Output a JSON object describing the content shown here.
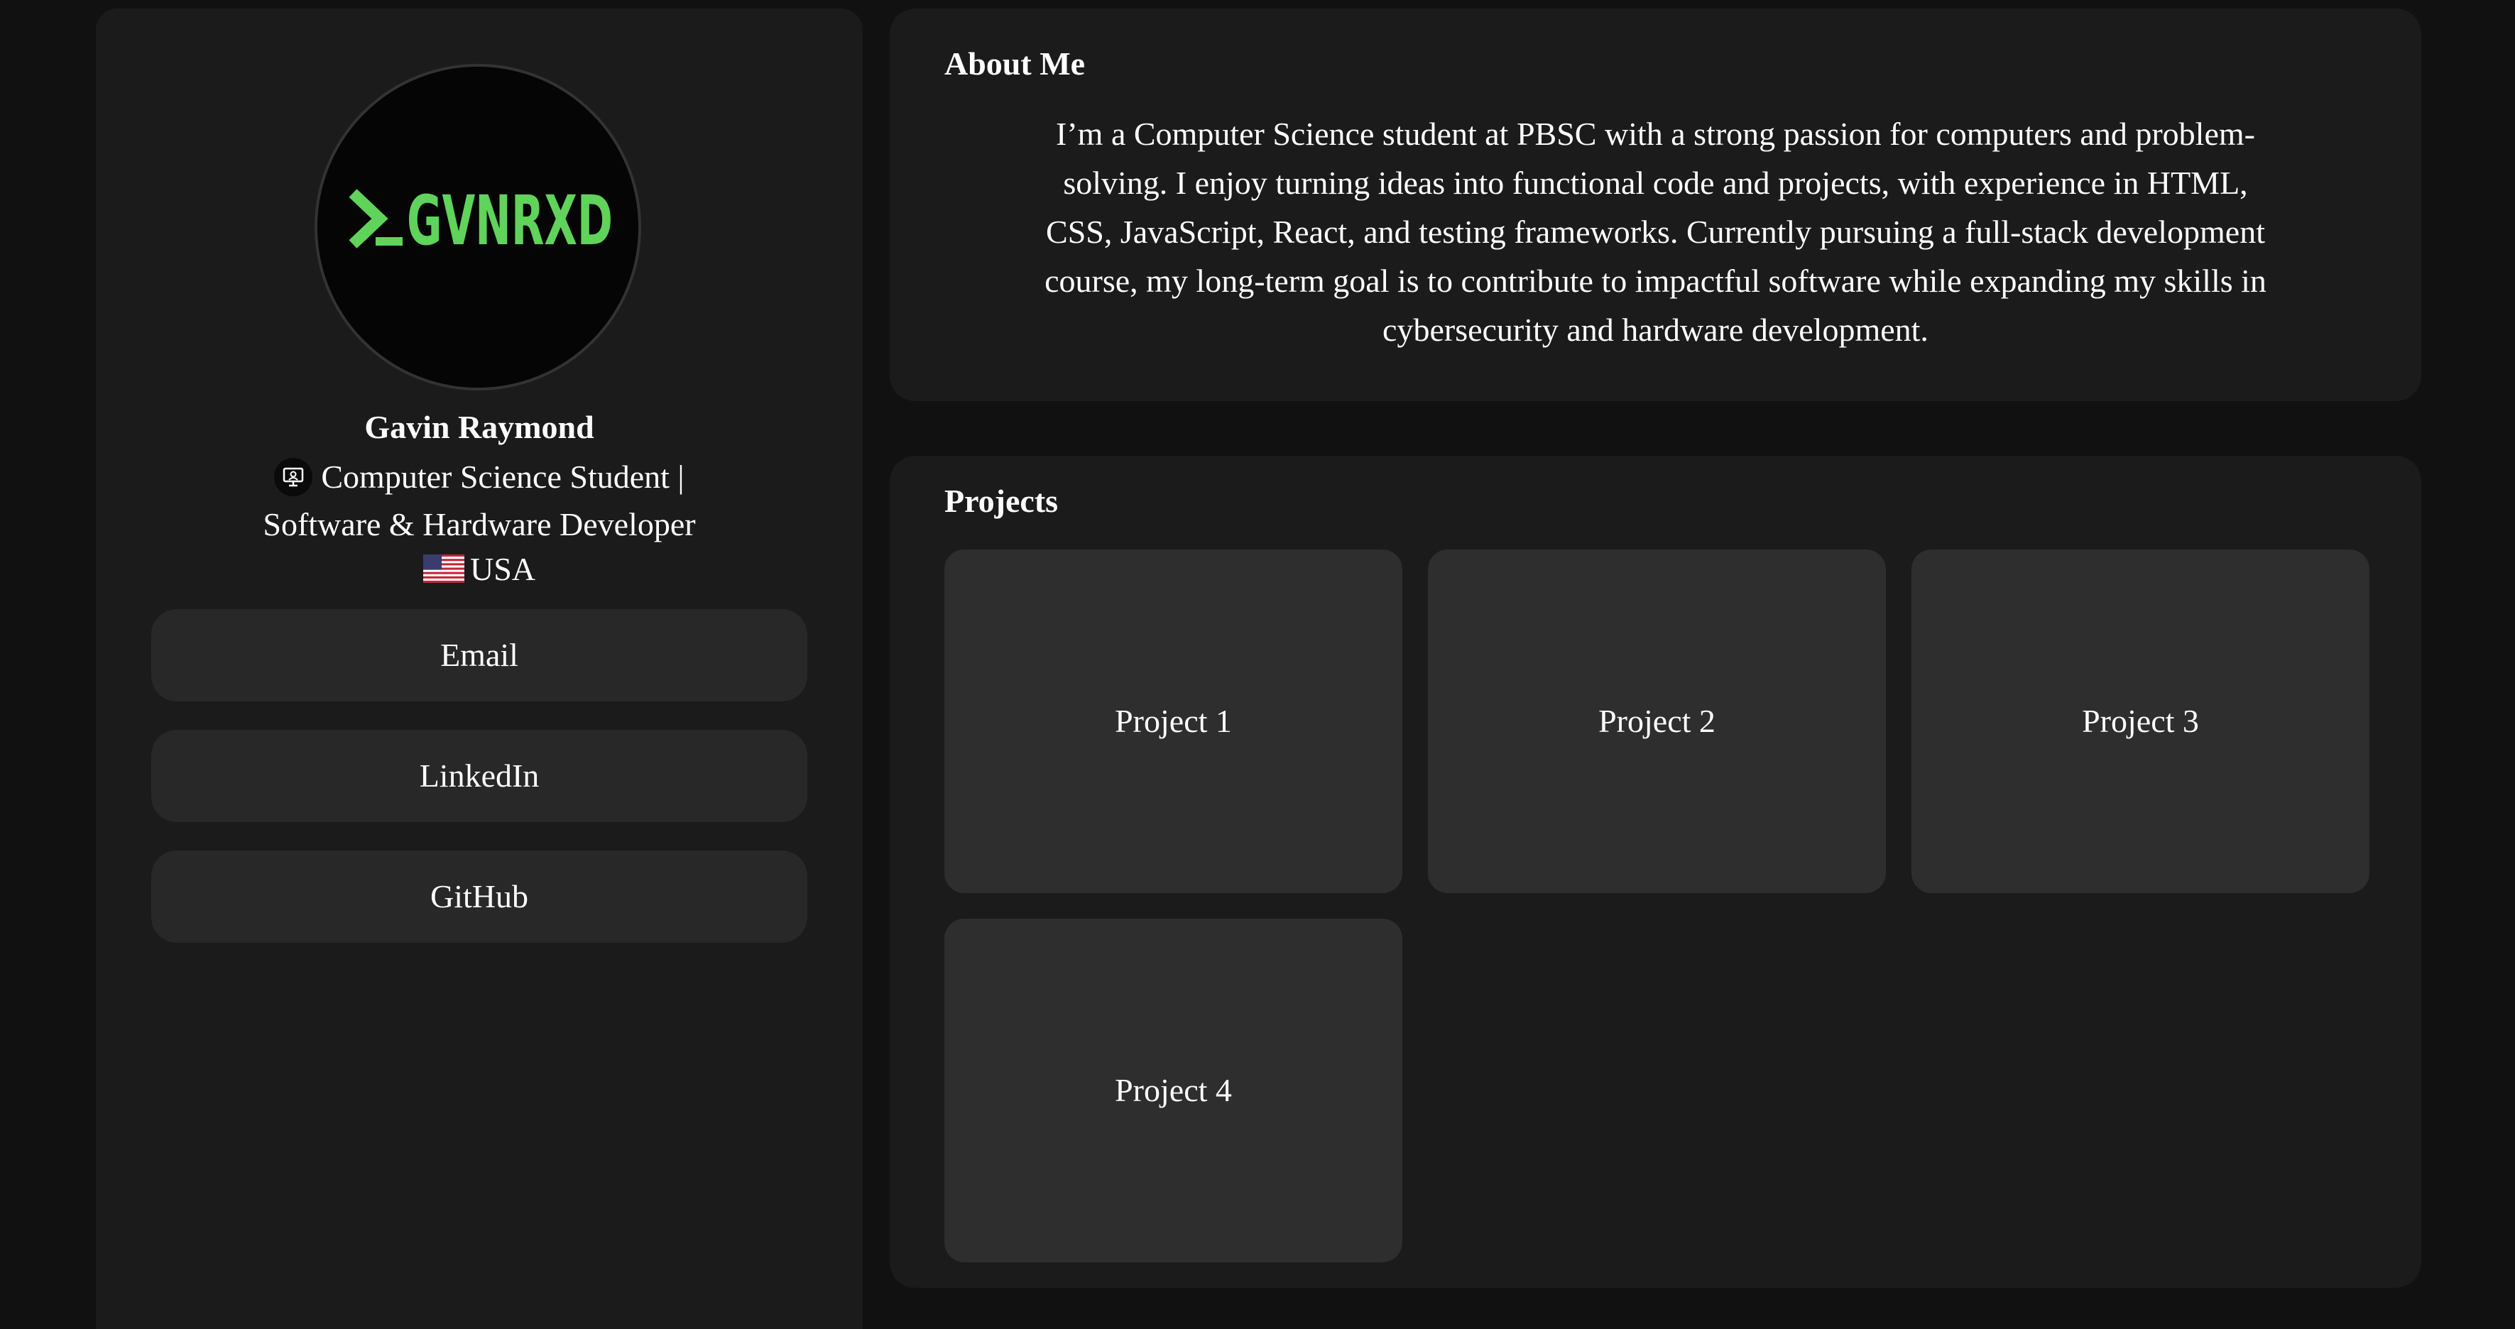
{
  "profile": {
    "logo_text": ">_GVNRXD",
    "name": "Gavin Raymond",
    "role": "Computer Science Student | Software & Hardware Developer",
    "location": "USA",
    "role_icon": "monitor-icon",
    "location_icon": "us-flag-icon"
  },
  "links": [
    {
      "label": "Email"
    },
    {
      "label": "LinkedIn"
    },
    {
      "label": "GitHub"
    }
  ],
  "about": {
    "title": "About Me",
    "text": "I’m a Computer Science student at PBSC with a strong passion for computers and problem-solving. I enjoy turning ideas into functional code and projects, with experience in HTML, CSS, JavaScript, React, and testing frameworks. Currently pursuing a full-stack development course, my long-term goal is to contribute to impactful software while expanding my skills in cybersecurity and hardware development."
  },
  "projects": {
    "title": "Projects",
    "items": [
      {
        "label": "Project 1"
      },
      {
        "label": "Project 2"
      },
      {
        "label": "Project 3"
      },
      {
        "label": "Project 4"
      }
    ]
  },
  "colors": {
    "background": "#111111",
    "panel": "#1b1b1b",
    "card": "#2e2e2e",
    "button": "#282828",
    "logo_green": "#5fd35a"
  }
}
